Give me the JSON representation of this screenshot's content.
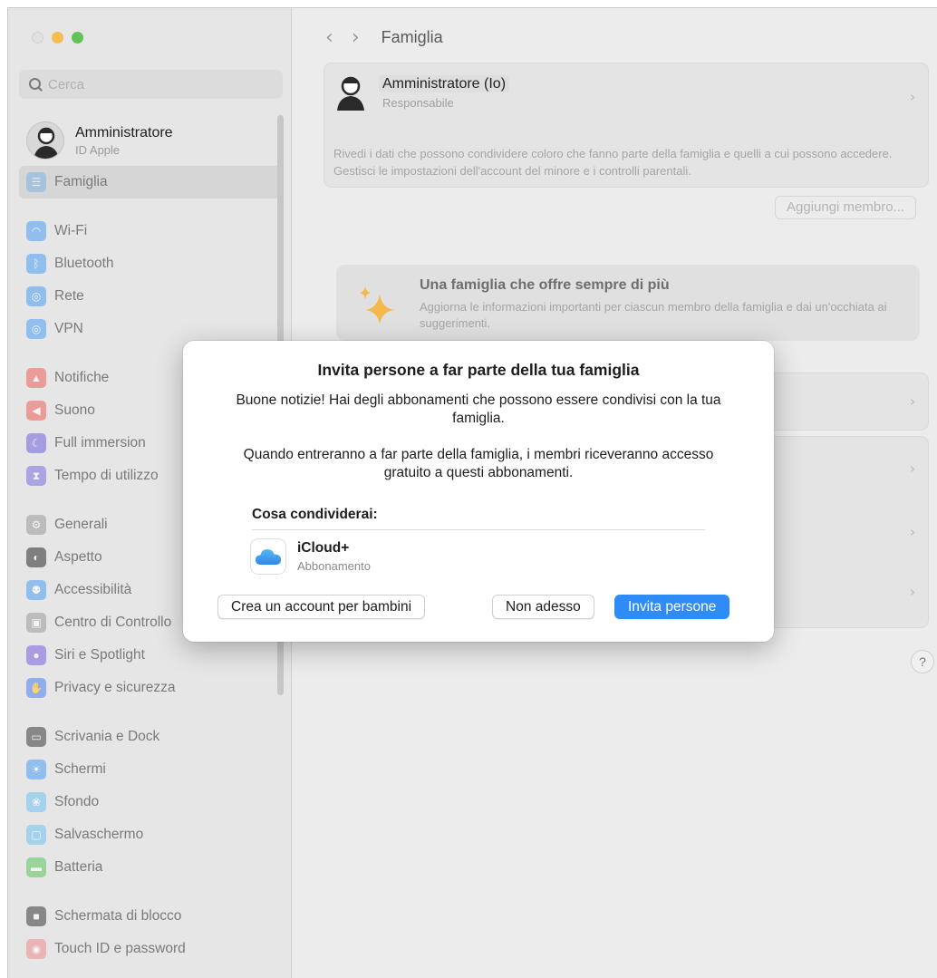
{
  "window": {
    "title": "Famiglia"
  },
  "sidebar": {
    "search_placeholder": "Cerca",
    "account": {
      "name": "Amministratore",
      "subtitle": "ID Apple"
    },
    "items": [
      {
        "label": "Famiglia",
        "icon": "family-icon",
        "color": "#7fb5e6",
        "active": true
      },
      {
        "label": "Wi-Fi",
        "icon": "wifi-icon",
        "color": "#4a9ff5"
      },
      {
        "label": "Bluetooth",
        "icon": "bluetooth-icon",
        "color": "#4a9ff5"
      },
      {
        "label": "Rete",
        "icon": "network-globe-icon",
        "color": "#4a9ff5"
      },
      {
        "label": "VPN",
        "icon": "vpn-globe-icon",
        "color": "#4a9ff5"
      },
      {
        "label": "Notifiche",
        "icon": "bell-icon",
        "color": "#f0605a"
      },
      {
        "label": "Suono",
        "icon": "speaker-icon",
        "color": "#f0605a"
      },
      {
        "label": "Full immersion",
        "icon": "moon-icon",
        "color": "#6f63e0"
      },
      {
        "label": "Tempo di utilizzo",
        "icon": "hourglass-icon",
        "color": "#7b6fe0"
      },
      {
        "label": "Generali",
        "icon": "gear-icon",
        "color": "#9a9a9a"
      },
      {
        "label": "Aspetto",
        "icon": "appearance-icon",
        "color": "#2c2c2c"
      },
      {
        "label": "Accessibilità",
        "icon": "accessibility-icon",
        "color": "#4a9ff5"
      },
      {
        "label": "Centro di Controllo",
        "icon": "control-center-icon",
        "color": "#9a9a9a"
      },
      {
        "label": "Siri e Spotlight",
        "icon": "siri-icon",
        "color": "#7a5fe0"
      },
      {
        "label": "Privacy e sicurezza",
        "icon": "hand-icon",
        "color": "#4a7ff5"
      },
      {
        "label": "Scrivania e Dock",
        "icon": "dock-icon",
        "color": "#3a3a3a"
      },
      {
        "label": "Schermi",
        "icon": "sun-icon",
        "color": "#4a9ff5"
      },
      {
        "label": "Sfondo",
        "icon": "wallpaper-icon",
        "color": "#6fc0f0"
      },
      {
        "label": "Salvaschermo",
        "icon": "screensaver-icon",
        "color": "#6fc0f0"
      },
      {
        "label": "Batteria",
        "icon": "battery-icon",
        "color": "#5cc85a"
      },
      {
        "label": "Schermata di blocco",
        "icon": "lock-icon",
        "color": "#3a3a3a"
      },
      {
        "label": "Touch ID e password",
        "icon": "fingerprint-icon",
        "color": "#f08a8a"
      }
    ]
  },
  "main": {
    "member": {
      "name": "Amministratore (Io)",
      "role": "Responsabile"
    },
    "description": "Rivedi i dati che possono condividere coloro che fanno parte della famiglia e quelli a cui possono accedere. Gestisci le impostazioni dell'account del minore e i controlli parentali.",
    "add_member_label": "Aggiungi membro...",
    "promo": {
      "title": "Una famiglia che offre sempre di più",
      "text": "Aggiorna le informazioni importanti per ciascun membro della famiglia e dai un'occhiata ai suggerimenti."
    },
    "help_label": "?"
  },
  "dialog": {
    "title": "Invita persone a far parte della tua famiglia",
    "paragraph1": "Buone notizie! Hai degli abbonamenti che possono essere condivisi con la tua famiglia.",
    "paragraph2": "Quando entreranno a far parte della famiglia, i membri riceveranno accesso gratuito a questi abbonamenti.",
    "share_heading": "Cosa condividerai:",
    "share_item": {
      "name": "iCloud+",
      "subtitle": "Abbonamento"
    },
    "buttons": {
      "create_child": "Crea un account per bambini",
      "not_now": "Non adesso",
      "invite": "Invita persone"
    },
    "accent_color": "#2f8cf6"
  }
}
